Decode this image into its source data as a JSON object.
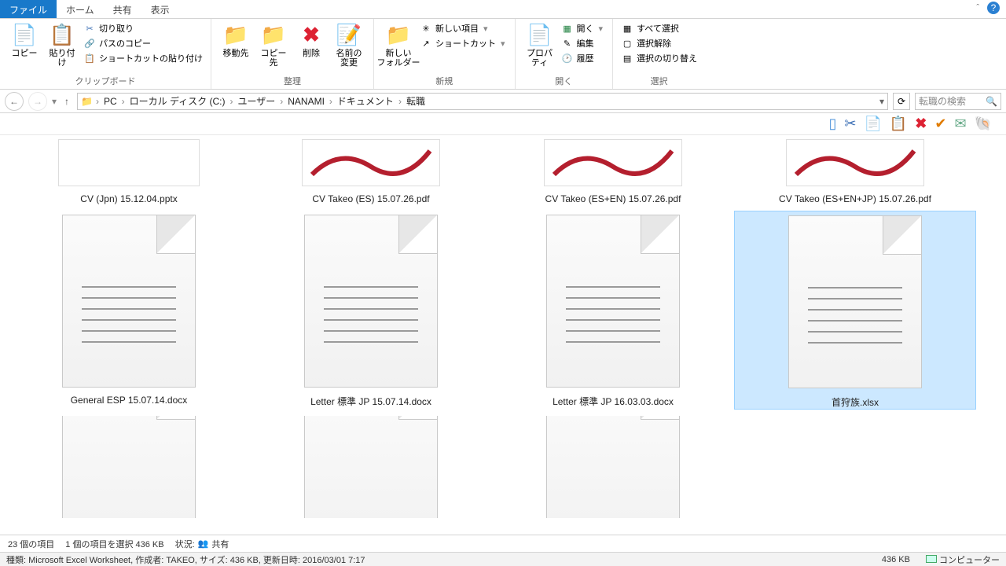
{
  "tabs": {
    "file": "ファイル",
    "home": "ホーム",
    "share": "共有",
    "view": "表示"
  },
  "ribbon": {
    "clipboard": {
      "copy": "コピー",
      "paste": "貼り付け",
      "cut": "切り取り",
      "copypath": "パスのコピー",
      "pasteshortcut": "ショートカットの貼り付け",
      "label": "クリップボード"
    },
    "organize": {
      "moveto": "移動先",
      "copyto": "コピー先",
      "delete": "削除",
      "rename": "名前の\n変更",
      "label": "整理"
    },
    "new": {
      "newfolder": "新しい\nフォルダー",
      "newitem": "新しい項目",
      "shortcut": "ショートカット",
      "label": "新規"
    },
    "open": {
      "properties": "プロパティ",
      "open": "開く",
      "edit": "編集",
      "history": "履歴",
      "label": "開く"
    },
    "select": {
      "selectall": "すべて選択",
      "selectnone": "選択解除",
      "invert": "選択の切り替え",
      "label": "選択"
    }
  },
  "breadcrumb": [
    "PC",
    "ローカル ディスク (C:)",
    "ユーザー",
    "NANAMI",
    "ドキュメント",
    "転職"
  ],
  "search": {
    "placeholder": "転職の検索"
  },
  "files": {
    "row1": [
      "CV (Jpn) 15.12.04.pptx",
      "CV Takeo (ES) 15.07.26.pdf",
      "CV Takeo (ES+EN) 15.07.26.pdf",
      "CV Takeo (ES+EN+JP) 15.07.26.pdf"
    ],
    "row2": [
      "General ESP 15.07.14.docx",
      "Letter 標準  JP  15.07.14.docx",
      "Letter 標準  JP  16.03.03.docx",
      "首狩族.xlsx"
    ]
  },
  "status": {
    "count": "23 個の項目",
    "selected": "1 個の項目を選択 436 KB",
    "state_label": "状況:",
    "shared": "共有"
  },
  "status2": {
    "detail": "種類: Microsoft Excel Worksheet, 作成者: TAKEO, サイズ: 436 KB, 更新日時: 2016/03/01 7:17",
    "size": "436 KB",
    "computer": "コンピューター"
  }
}
